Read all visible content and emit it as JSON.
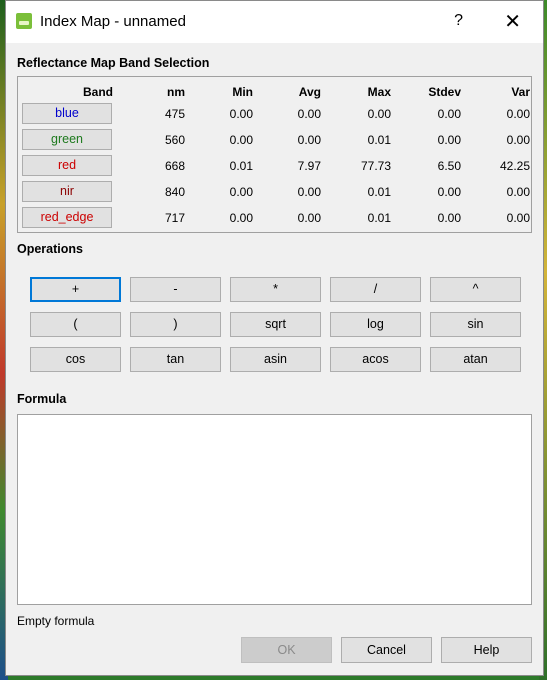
{
  "window": {
    "title": "Index Map - unnamed",
    "help": "?",
    "close": "✕"
  },
  "band_section": {
    "title": "Reflectance Map Band Selection"
  },
  "columns": [
    "Band",
    "nm",
    "Min",
    "Avg",
    "Max",
    "Stdev",
    "Var"
  ],
  "bands": [
    {
      "name": "blue",
      "color": "#0000cc",
      "nm": "475",
      "min": "0.00",
      "avg": "0.00",
      "max": "0.00",
      "stdev": "0.00",
      "var": "0.00"
    },
    {
      "name": "green",
      "color": "#1e7a1e",
      "nm": "560",
      "min": "0.00",
      "avg": "0.00",
      "max": "0.01",
      "stdev": "0.00",
      "var": "0.00"
    },
    {
      "name": "red",
      "color": "#cc0000",
      "nm": "668",
      "min": "0.01",
      "avg": "7.97",
      "max": "77.73",
      "stdev": "6.50",
      "var": "42.25"
    },
    {
      "name": "nir",
      "color": "#8b0000",
      "nm": "840",
      "min": "0.00",
      "avg": "0.00",
      "max": "0.01",
      "stdev": "0.00",
      "var": "0.00"
    },
    {
      "name": "red_edge",
      "color": "#cc0000",
      "nm": "717",
      "min": "0.00",
      "avg": "0.00",
      "max": "0.01",
      "stdev": "0.00",
      "var": "0.00"
    }
  ],
  "operations": {
    "title": "Operations",
    "rows": [
      [
        "+",
        "-",
        "*",
        "/",
        "^"
      ],
      [
        "(",
        ")",
        "sqrt",
        "log",
        "sin"
      ],
      [
        "cos",
        "tan",
        "asin",
        "acos",
        "atan"
      ]
    ]
  },
  "formula": {
    "title": "Formula",
    "value": "",
    "status": "Empty formula"
  },
  "footer": {
    "ok": "OK",
    "cancel": "Cancel",
    "help": "Help"
  },
  "colors": {
    "accent": "#0078d7",
    "icon": "#7bbf3a"
  }
}
